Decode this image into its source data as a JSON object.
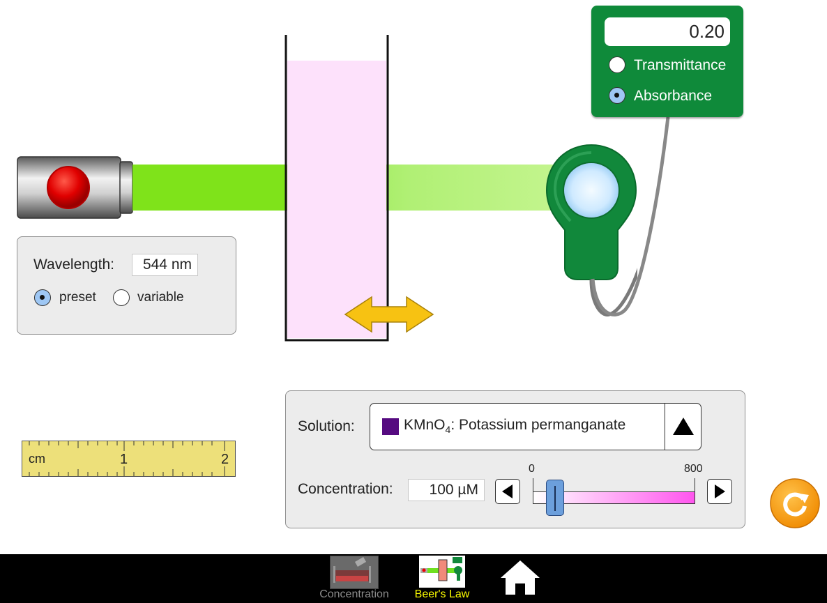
{
  "wavelength": {
    "label": "Wavelength:",
    "value": "544 nm",
    "modes": [
      {
        "label": "preset",
        "selected": true
      },
      {
        "label": "variable",
        "selected": false
      }
    ]
  },
  "detector": {
    "value": "0.20",
    "modes": [
      {
        "label": "Transmittance",
        "selected": false
      },
      {
        "label": "Absorbance",
        "selected": true
      }
    ]
  },
  "ruler": {
    "unit": "cm",
    "ticks": [
      "1",
      "2"
    ]
  },
  "solution": {
    "label": "Solution:",
    "formula_main": "KMnO",
    "formula_sub": "4",
    "formula_rest": ": Potassium permanganate",
    "swatch_color": "#550a80"
  },
  "concentration": {
    "label": "Concentration:",
    "value": "100 µM",
    "min_label": "0",
    "max_label": "800",
    "min": 0,
    "max": 800,
    "current": 100
  },
  "navbar": {
    "tabs": [
      {
        "label": "Concentration",
        "active": false
      },
      {
        "label": "Beer's Law",
        "active": true
      }
    ]
  },
  "colors": {
    "beam": "#7fe31a",
    "meter": "#0f8a3a",
    "active_tab": "#ffff00",
    "inactive_tab": "#8c8c8c"
  }
}
